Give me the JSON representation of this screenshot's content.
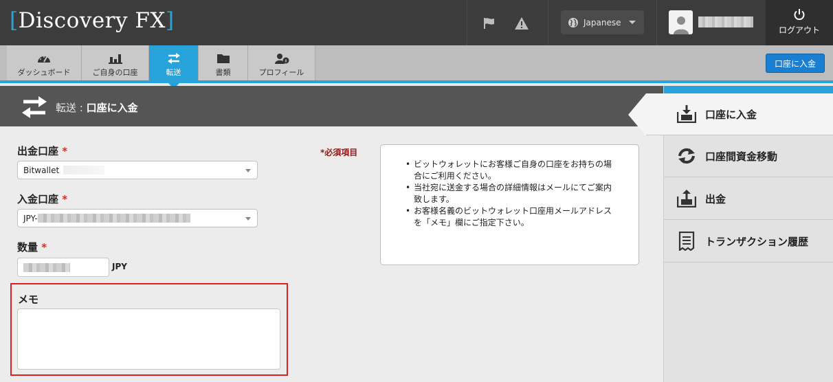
{
  "header": {
    "logo_bracket_open": "[",
    "logo_text": "Discovery FX",
    "logo_bracket_close": "]",
    "language": "Japanese",
    "logout_label": "ログアウト"
  },
  "nav": {
    "tabs": [
      {
        "label": "ダッシュボード",
        "icon": "dashboard-icon"
      },
      {
        "label": "ご自身の口座",
        "icon": "bar-chart-icon"
      },
      {
        "label": "転送",
        "icon": "transfer-icon",
        "active": true
      },
      {
        "label": "書類",
        "icon": "folder-icon"
      },
      {
        "label": "プロフィール",
        "icon": "user-info-icon"
      }
    ],
    "deposit_button": "口座に入金"
  },
  "page_header": {
    "section": "転送 : ",
    "title": "口座に入金"
  },
  "form": {
    "required_note": "*必須項目",
    "withdraw_account_label": "出金口座",
    "withdraw_account_value": "Bitwallet",
    "deposit_account_label": "入金口座",
    "deposit_account_value_prefix": "JPY-",
    "amount_label": "数量",
    "amount_unit": "JPY",
    "memo_label": "メモ",
    "required_mark": "*"
  },
  "info": {
    "items": [
      "ビットウォレットにお客様ご自身の口座をお持ちの場合にご利用ください。",
      "当社宛に送金する場合の詳細情報はメールにてご案内致します。",
      "お客様名義のビットウォレット口座用メールアドレスを「メモ」欄にご指定下さい。"
    ]
  },
  "sidebar": {
    "items": [
      {
        "label": "口座に入金",
        "icon": "deposit-icon",
        "active": true
      },
      {
        "label": "口座間資金移動",
        "icon": "internal-transfer-icon"
      },
      {
        "label": "出金",
        "icon": "withdraw-icon"
      },
      {
        "label": "トランザクション履歴",
        "icon": "receipt-icon"
      }
    ]
  },
  "colors": {
    "accent": "#27a3d9",
    "header_bg": "#3c3c3c",
    "highlight_border": "#d9221f",
    "primary_button": "#1a7fd1"
  }
}
